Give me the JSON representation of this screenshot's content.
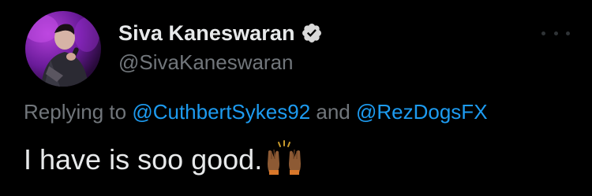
{
  "author": {
    "display_name": "Siva Kaneswaran",
    "handle": "@SivaKaneswaran",
    "verified": true,
    "verified_icon": "verified-badge-icon"
  },
  "reply": {
    "prefix": "Replying to ",
    "mention_1": "@CuthbertSykes92",
    "conjunction": " and ",
    "mention_2": "@RezDogsFX"
  },
  "tweet": {
    "text": "I have is soo good.",
    "emoji_icon": "raising-hands-icon"
  },
  "more_icon": "more-options-icon",
  "colors": {
    "background": "#000000",
    "primary_text": "#e7e9ea",
    "secondary_text": "#71767b",
    "link": "#1d9bf0",
    "verified_badge": "#d9d9d9"
  }
}
